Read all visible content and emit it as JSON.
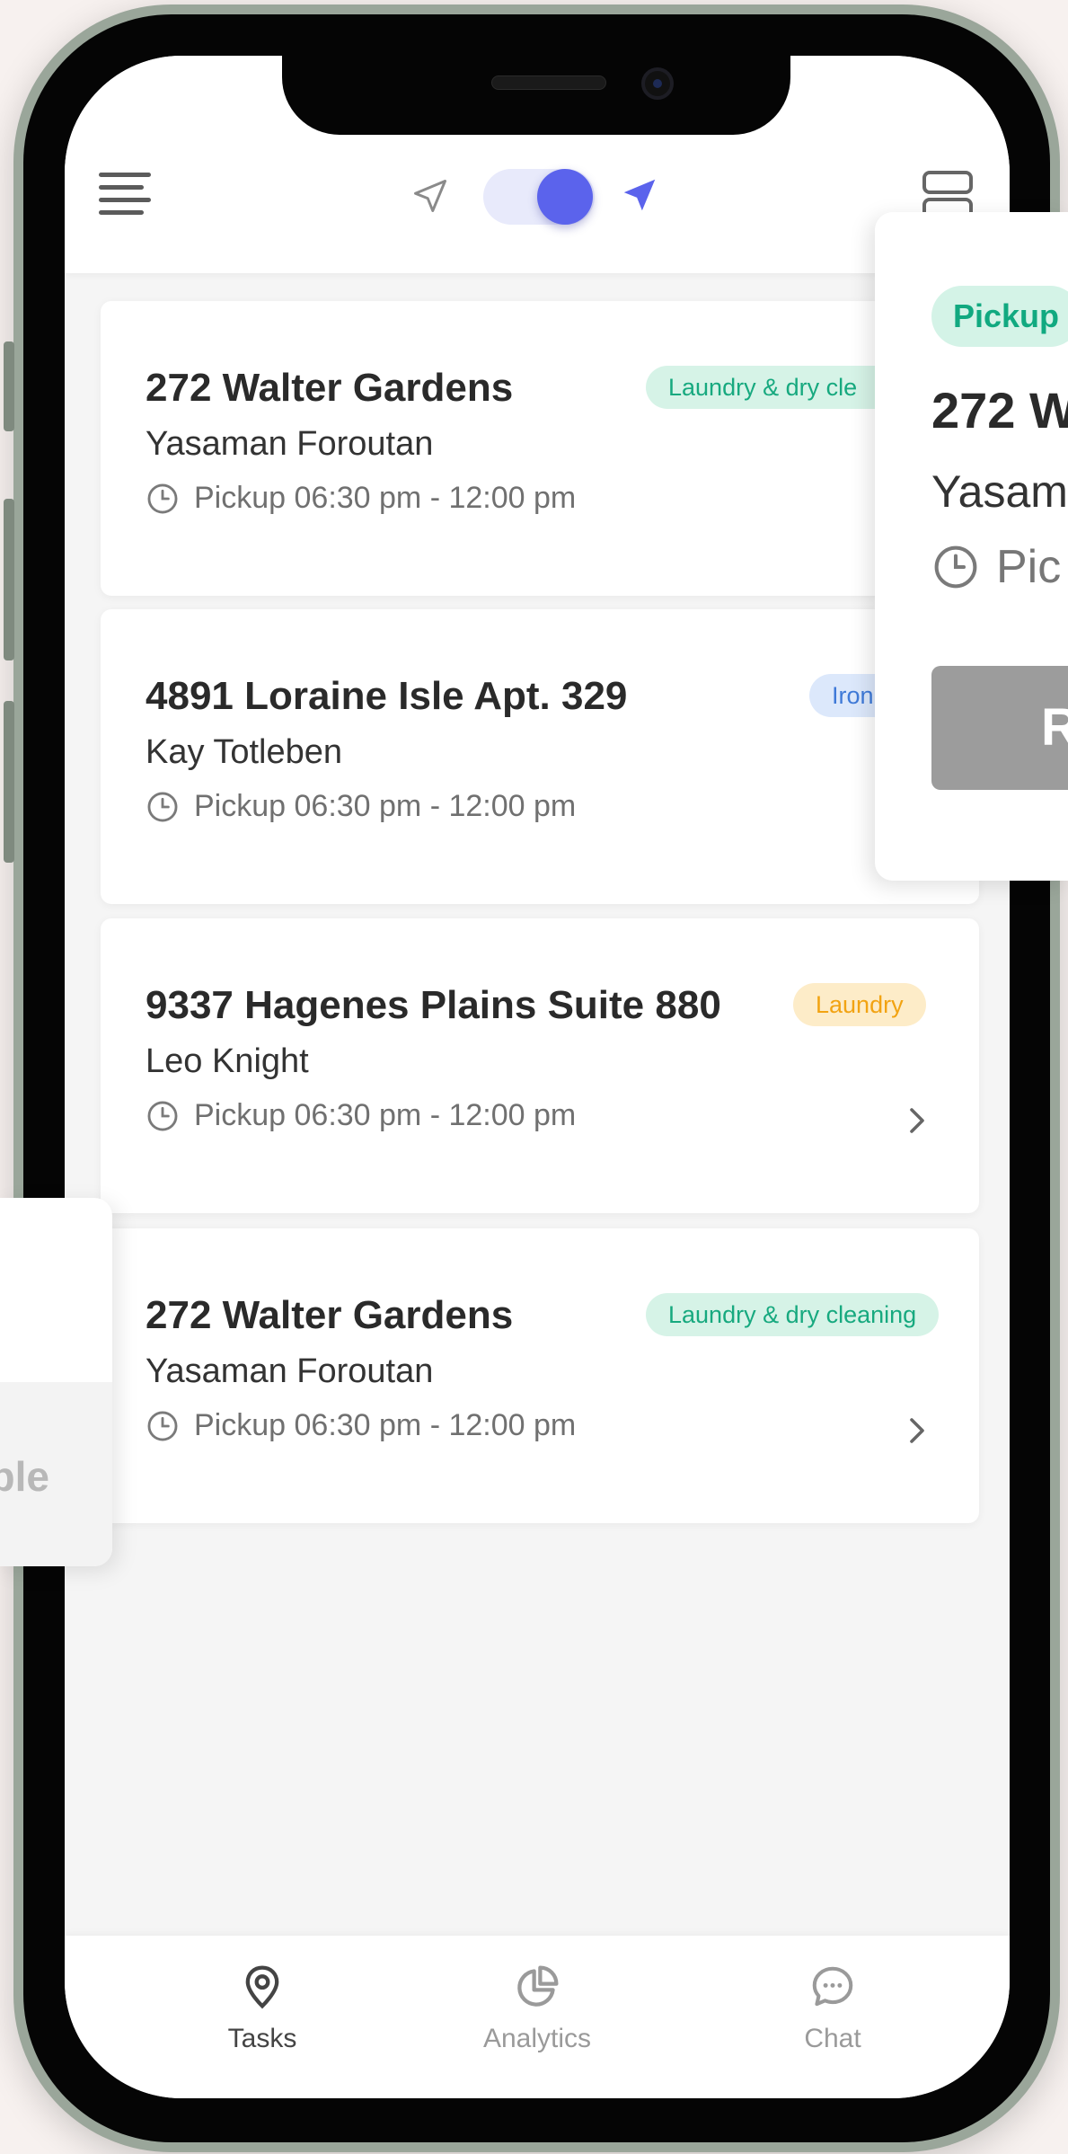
{
  "header": {
    "menu_icon": "hamburger-menu-icon",
    "navigation_off_icon": "navigation-arrow-outline-icon",
    "navigation_on_icon": "navigation-arrow-filled-icon",
    "layout_icon": "split-view-icon",
    "toggle_on": true,
    "accent_color": "#5b63ec"
  },
  "tasks": [
    {
      "address": "272 Walter Gardens",
      "customer": "Yasaman Foroutan",
      "time": "Pickup 06:30 pm - 12:00 pm",
      "tag": "Laundry & dry cle"
    },
    {
      "address": "4891 Loraine Isle Apt. 329",
      "customer": "Kay Totleben",
      "time": "Pickup 06:30 pm - 12:00 pm",
      "tag": "Iron"
    },
    {
      "address": "9337 Hagenes Plains Suite 880",
      "customer": "Leo Knight",
      "time": "Pickup 06:30 pm - 12:00 pm",
      "tag": "Laundry"
    },
    {
      "address": "272 Walter Gardens",
      "customer": "Yasaman Foroutan",
      "time": "Pickup 06:30 pm - 12:00 pm",
      "tag": "Laundry & dry cleaning"
    }
  ],
  "tag_colors": {
    "laundry_dry_cleaning": {
      "bg": "#d6f3e7",
      "fg": "#17a97f"
    },
    "iron": {
      "bg": "#dce8fb",
      "fg": "#3f7ad8"
    },
    "laundry": {
      "bg": "#fdecc8",
      "fg": "#f2a312"
    }
  },
  "detail_panel": {
    "badge": "Pickup",
    "address": "272 W",
    "customer": "Yasam",
    "time": "Pic",
    "button": "R"
  },
  "left_panel": {
    "text": "ble"
  },
  "bottom_nav": {
    "items": [
      {
        "label": "Tasks",
        "icon": "location-pin-icon",
        "active": true
      },
      {
        "label": "Analytics",
        "icon": "pie-chart-icon",
        "active": false
      },
      {
        "label": "Chat",
        "icon": "chat-bubble-icon",
        "active": false
      }
    ]
  }
}
